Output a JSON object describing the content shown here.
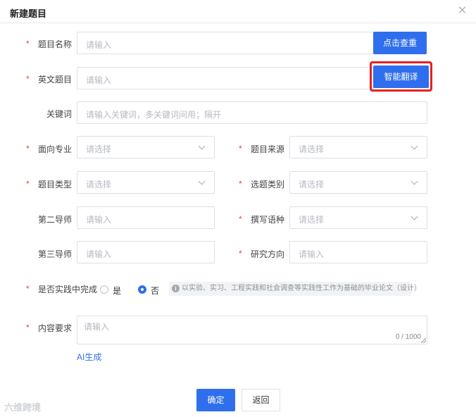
{
  "dialog": {
    "title": "新建题目"
  },
  "fields": {
    "title_name": {
      "label": "题目名称",
      "placeholder": "请输入",
      "check_button": "点击查重"
    },
    "english_title": {
      "label": "英文题目",
      "placeholder": "请输入",
      "translate_button": "智能翻译"
    },
    "keywords": {
      "label": "关键词",
      "placeholder": "请输入关键词，多关键词间用；隔开"
    },
    "major": {
      "label": "面向专业",
      "placeholder": "请选择"
    },
    "source": {
      "label": "题目来源",
      "placeholder": "请选择"
    },
    "type": {
      "label": "题目类型",
      "placeholder": "请选择"
    },
    "category": {
      "label": "选题类别",
      "placeholder": "请选择"
    },
    "second_tutor": {
      "label": "第二导师",
      "placeholder": "请输入"
    },
    "language": {
      "label": "撰写语种",
      "placeholder": "请选择"
    },
    "third_tutor": {
      "label": "第三导师",
      "placeholder": "请输入"
    },
    "direction": {
      "label": "研究方向",
      "placeholder": "请输入"
    },
    "practice": {
      "label": "是否实践中完成",
      "options": [
        "是",
        "否"
      ],
      "selected": "否",
      "hint": "以实验、实习、工程实践和社会调查等实践性工作为基础的毕业论文（设计）"
    },
    "content": {
      "label": "内容要求",
      "placeholder": "请输入",
      "counter": "0 / 1000"
    }
  },
  "ai_generate_link": "AI生成",
  "footer": {
    "confirm": "确定",
    "back": "返回"
  },
  "watermark": "六维跨境",
  "colors": {
    "primary": "#2f6fed",
    "required": "#f04134",
    "highlight": "#e8201f"
  }
}
